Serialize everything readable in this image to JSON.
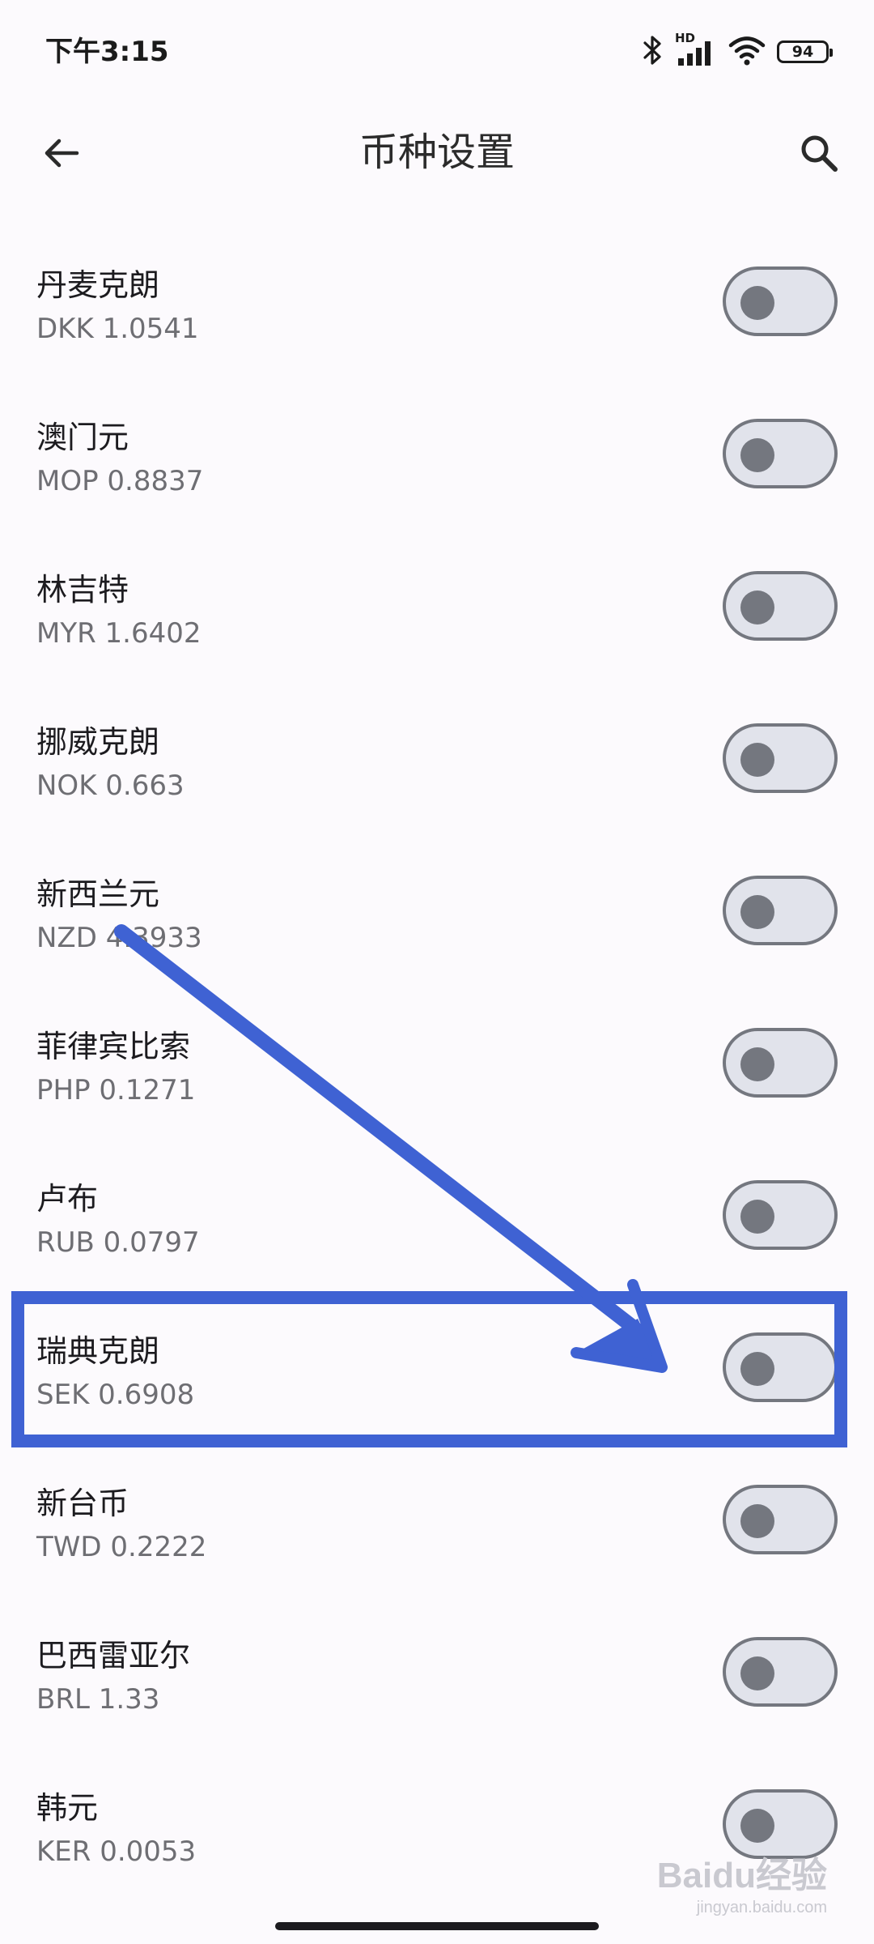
{
  "status_bar": {
    "time": "下午3:15",
    "network_label": "HD",
    "battery_level": "94",
    "icons": [
      "bluetooth-icon",
      "signal-icon",
      "wifi-icon",
      "battery-icon"
    ]
  },
  "header": {
    "title": "币种设置",
    "back_icon": "arrow-left-icon",
    "search_icon": "search-icon"
  },
  "currencies": [
    {
      "name": "丹麦克朗",
      "rate": "DKK 1.0541",
      "enabled": false
    },
    {
      "name": "澳门元",
      "rate": "MOP 0.8837",
      "enabled": false
    },
    {
      "name": "林吉特",
      "rate": "MYR 1.6402",
      "enabled": false
    },
    {
      "name": "挪威克朗",
      "rate": "NOK 0.663",
      "enabled": false
    },
    {
      "name": "新西兰元",
      "rate": "NZD 4.3933",
      "enabled": false
    },
    {
      "name": "菲律宾比索",
      "rate": "PHP 0.1271",
      "enabled": false
    },
    {
      "name": "卢布",
      "rate": "RUB 0.0797",
      "enabled": false
    },
    {
      "name": "瑞典克朗",
      "rate": "SEK 0.6908",
      "enabled": false
    },
    {
      "name": "新台币",
      "rate": "TWD 0.2222",
      "enabled": false
    },
    {
      "name": "巴西雷亚尔",
      "rate": "BRL 1.33",
      "enabled": false
    },
    {
      "name": "韩元",
      "rate": "KER 0.0053",
      "enabled": false
    }
  ],
  "annotation": {
    "highlight_color": "#3f62d3"
  },
  "watermark": {
    "logo": "Baidu经验",
    "url": "jingyan.baidu.com"
  },
  "colors": {
    "background": "#fcfafd",
    "toggle_track": "#e1e3eb",
    "toggle_outline": "#74777f",
    "secondary_text": "#6e6e73"
  }
}
